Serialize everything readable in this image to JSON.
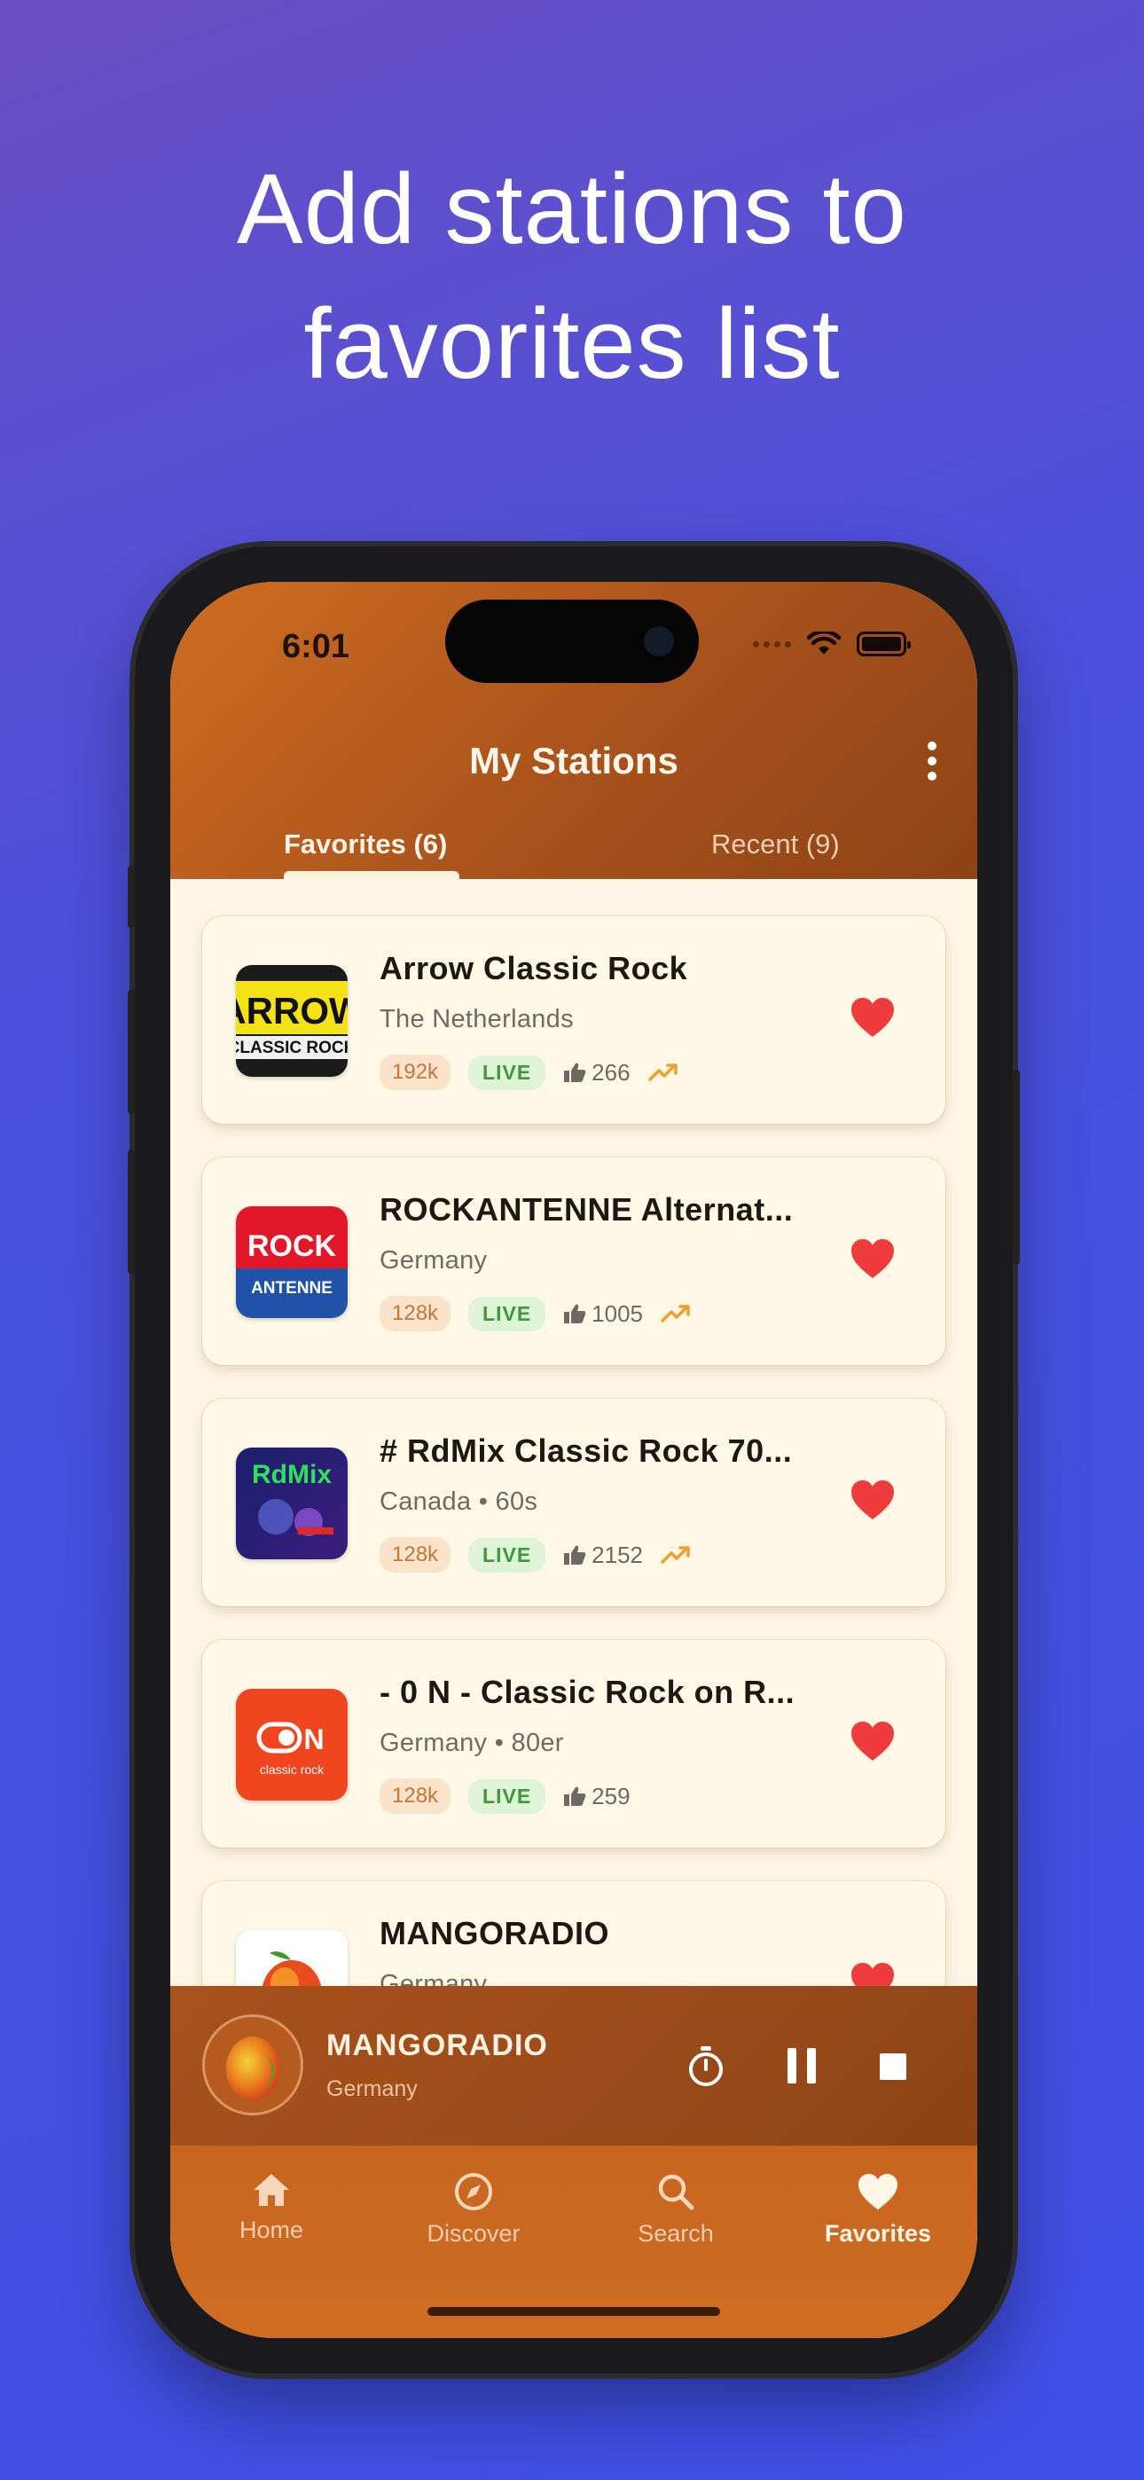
{
  "headline": {
    "line1": "Add stations to",
    "line2": "favorites list"
  },
  "status_bar": {
    "time": "6:01"
  },
  "header": {
    "title": "My Stations",
    "tabs": [
      {
        "label": "Favorites (6)",
        "active": true
      },
      {
        "label": "Recent (9)",
        "active": false
      }
    ]
  },
  "stations": [
    {
      "name": "Arrow Classic Rock",
      "country": "The Netherlands",
      "bitrate": "192k",
      "live": "LIVE",
      "likes": "266",
      "trending": true,
      "logo": "ARROW CLASSIC ROCK"
    },
    {
      "name": "ROCKANTENNE Alternat...",
      "country": "Germany",
      "bitrate": "128k",
      "live": "LIVE",
      "likes": "1005",
      "trending": true,
      "logo": "ROCK ANTENNE"
    },
    {
      "name": "# RdMix Classic Rock 70...",
      "country": "Canada • 60s",
      "bitrate": "128k",
      "live": "LIVE",
      "likes": "2152",
      "trending": true,
      "logo": "RdMix"
    },
    {
      "name": "- 0 N - Classic Rock on R...",
      "country": "Germany • 80er",
      "bitrate": "128k",
      "live": "LIVE",
      "likes": "259",
      "trending": false,
      "logo": "ON classic rock"
    },
    {
      "name": "MANGORADIO",
      "country": "Germany",
      "bitrate": "",
      "live": "",
      "likes": "",
      "trending": false,
      "logo": "mango"
    }
  ],
  "player": {
    "name": "MANGORADIO",
    "country": "Germany"
  },
  "nav": {
    "home": "Home",
    "discover": "Discover",
    "search": "Search",
    "favorites": "Favorites"
  },
  "colors": {
    "accent": "#cf6d22",
    "heart": "#ef3b3b",
    "background": "#3f4fe6"
  }
}
